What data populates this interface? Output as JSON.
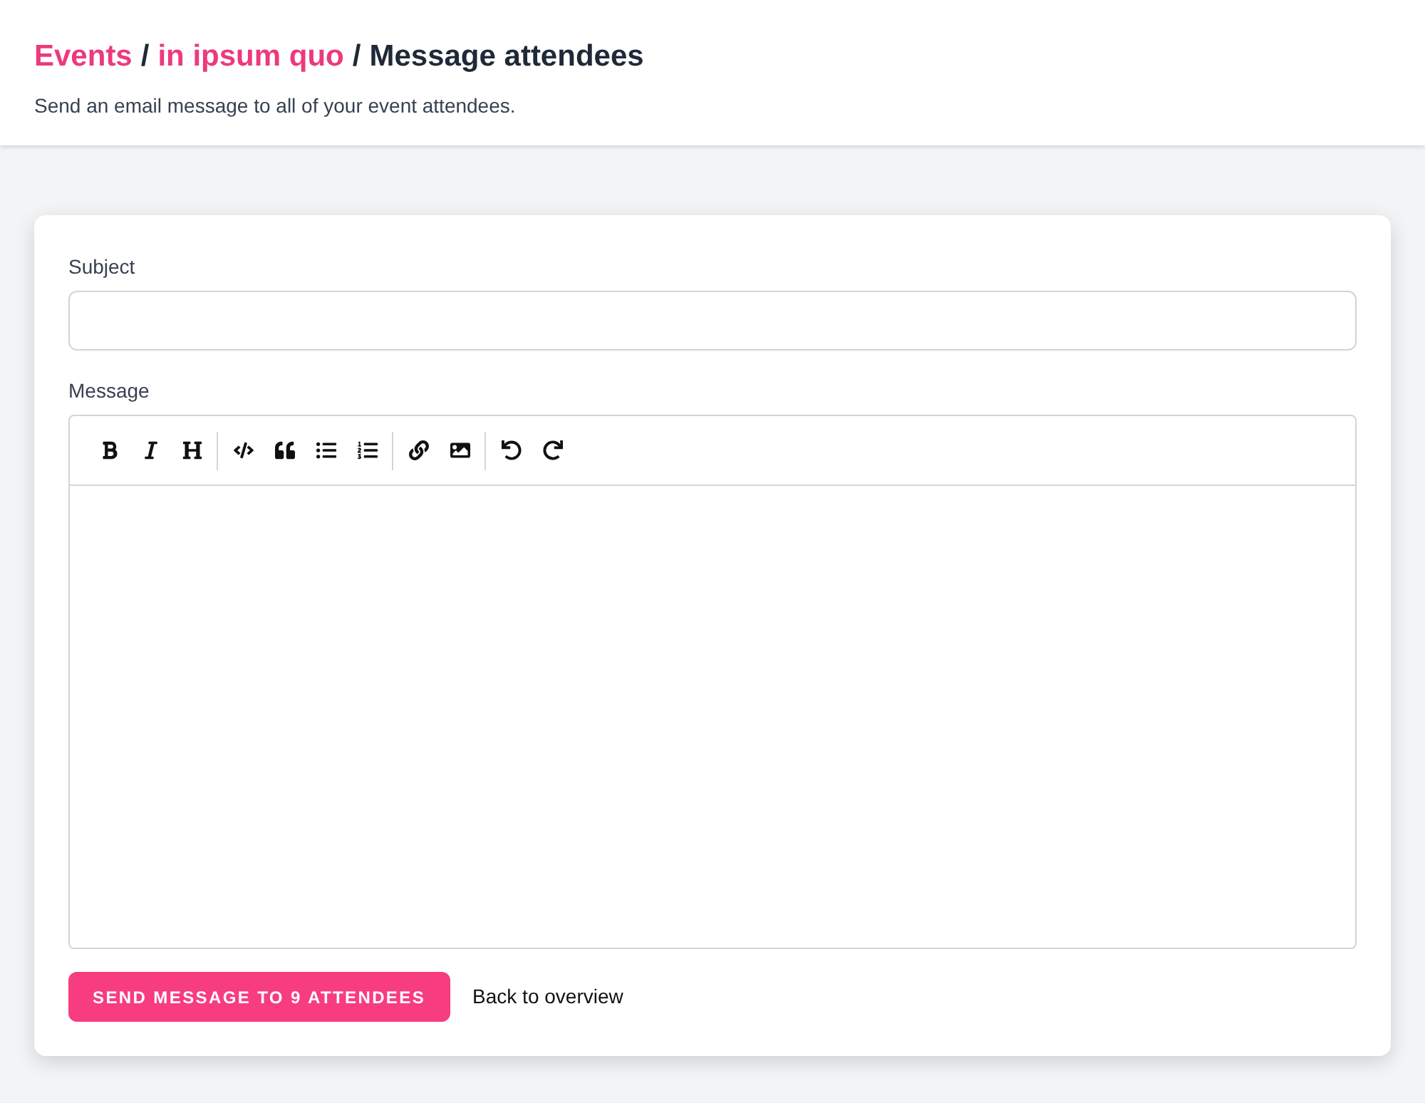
{
  "header": {
    "breadcrumb": [
      {
        "label": "Events",
        "kind": "link"
      },
      {
        "label": "in ipsum quo",
        "kind": "link"
      },
      {
        "label": "Message attendees",
        "kind": "current"
      }
    ],
    "separator": "/",
    "description": "Send an email message to all of your event attendees."
  },
  "form": {
    "subject": {
      "label": "Subject"
    },
    "message": {
      "label": "Message"
    }
  },
  "actions": {
    "submit": "SEND MESSAGE TO 9 ATTENDEES",
    "back": "Back to overview"
  }
}
